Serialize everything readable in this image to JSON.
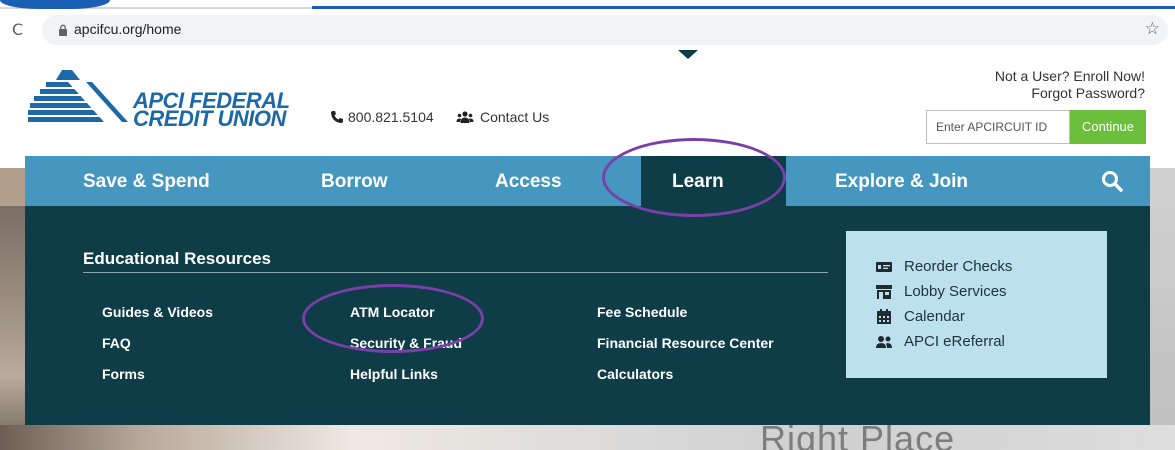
{
  "browser": {
    "url": "apcifcu.org/home"
  },
  "header": {
    "logo_line1": "APCI FEDERAL",
    "logo_line2": "CREDIT UNION",
    "phone": "800.821.5104",
    "contact": "Contact Us",
    "enroll": "Not a User? Enroll Now!",
    "forgot": "Forgot Password?",
    "login_placeholder": "Enter APCIRCUIT ID",
    "continue_label": "Continue"
  },
  "nav": {
    "items": [
      "Save & Spend",
      "Borrow",
      "Access",
      "Learn",
      "Explore & Join"
    ],
    "active": "Learn"
  },
  "dropdown": {
    "title": "Educational Resources",
    "col1": [
      "Guides & Videos",
      "FAQ",
      "Forms"
    ],
    "col2": [
      "ATM Locator",
      "Security & Fraud",
      "Helpful Links"
    ],
    "col3": [
      "Fee Schedule",
      "Financial Resource Center",
      "Calculators"
    ],
    "quick_links": [
      "Reorder Checks",
      "Lobby Services",
      "Calendar",
      "APCI eReferral"
    ]
  },
  "hero": {
    "partial_text": "Right Place"
  },
  "colors": {
    "nav_blue": "#4597bf",
    "nav_dark": "#0e3c47",
    "brand_blue": "#1d69a8",
    "continue_green": "#6cbf3a",
    "quick_box": "#bde0ee",
    "annotation_purple": "#7a3fa8"
  }
}
